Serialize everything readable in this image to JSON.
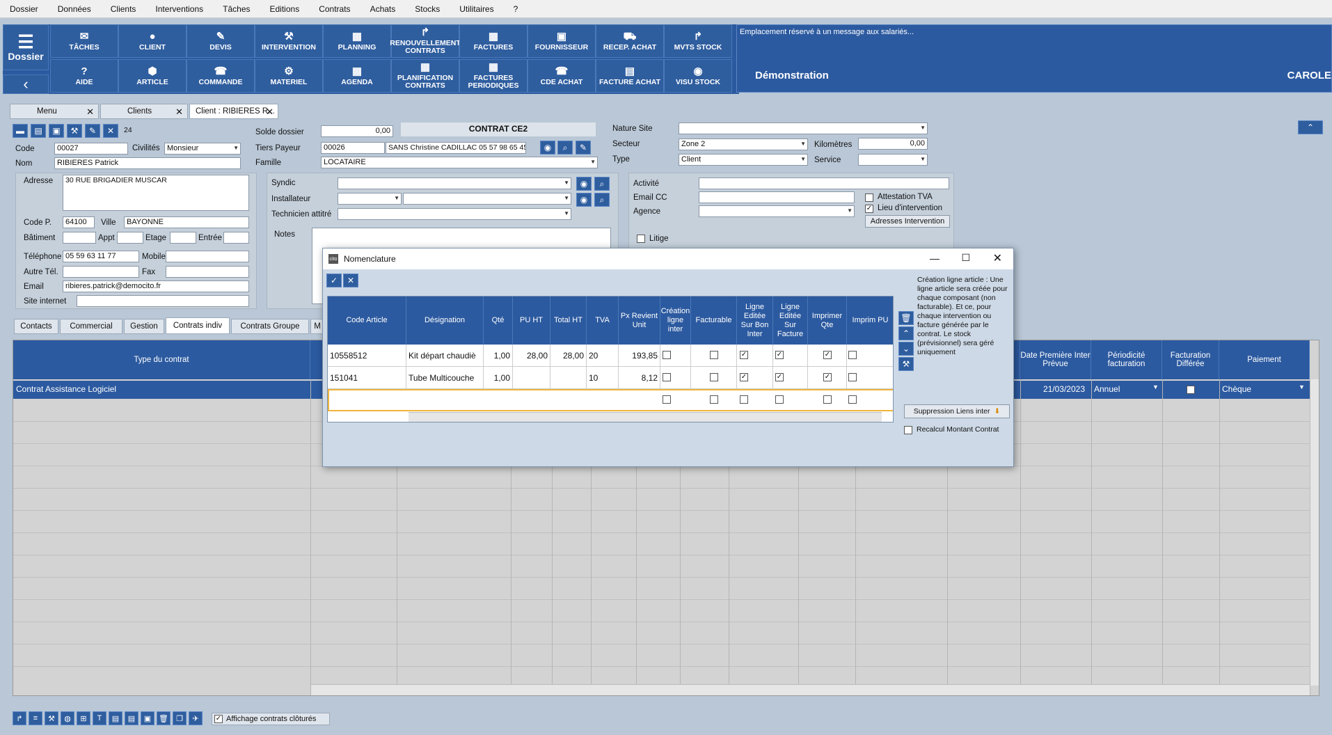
{
  "menu": [
    "Dossier",
    "Données",
    "Clients",
    "Interventions",
    "Tâches",
    "Editions",
    "Contrats",
    "Achats",
    "Stocks",
    "Utilitaires",
    "?"
  ],
  "toolbar": {
    "dossier": "Dossier",
    "row1": [
      "TÂCHES",
      "CLIENT",
      "DEVIS",
      "INTERVENTION",
      "PLANNING",
      "RENOUVELLEMENT CONTRATS",
      "FACTURES",
      "FOURNISSEUR",
      "RECEP. ACHAT",
      "MVTS STOCK"
    ],
    "row2": [
      "AIDE",
      "ARTICLE",
      "COMMANDE",
      "MATERIEL",
      "AGENDA",
      "PLANIFICATION CONTRATS",
      "FACTURES PERIODIQUES",
      "CDE ACHAT",
      "FACTURE ACHAT",
      "VISU STOCK"
    ]
  },
  "message": {
    "text": "Emplacement réservé à un  message aux salariés...",
    "company": "Démonstration",
    "user": "CAROLE"
  },
  "tabs": [
    "Menu",
    "Clients",
    "Client : RIBIERES R..."
  ],
  "form": {
    "count": "24",
    "code_label": "Code",
    "code": "00027",
    "civ_label": "Civilités",
    "civ": "Monsieur",
    "nom_label": "Nom",
    "nom": "RIBIERES Patrick",
    "solde_label": "Solde dossier",
    "solde": "0,00",
    "contrat_title": "CONTRAT CE2",
    "tiers_label": "Tiers Payeur",
    "tiers_code": "00026",
    "tiers_name": "SANS Christine CADILLAC 05 57 98 65 45",
    "famille_label": "Famille",
    "famille": "LOCATAIRE",
    "nature_label": "Nature Site",
    "secteur_label": "Secteur",
    "secteur": "Zone 2",
    "km_label": "Kilomètres",
    "km": "0,00",
    "type_label": "Type",
    "type": "Client",
    "service_label": "Service",
    "adresse_label": "Adresse",
    "adresse": "30 RUE BRIGADIER MUSCAR",
    "cp_label": "Code P.",
    "cp": "64100",
    "ville_label": "Ville",
    "ville": "BAYONNE",
    "bat_label": "Bâtiment",
    "appt_label": "Appt",
    "etage_label": "Etage",
    "entree_label": "Entrée",
    "tel_label": "Téléphone",
    "tel": "05 59 63 11 77",
    "mobile_label": "Mobile",
    "autre_label": "Autre Tél.",
    "fax_label": "Fax",
    "email_label": "Email",
    "email": "ribieres.patrick@democito.fr",
    "site_label": "Site internet",
    "syndic_label": "Syndic",
    "install_label": "Installateur",
    "tech_label": "Technicien attitré",
    "notes_label": "Notes",
    "activite_label": "Activité",
    "emailcc_label": "Email CC",
    "agence_label": "Agence",
    "attest_label": "Attestation TVA",
    "lieu_label": "Lieu d'intervention",
    "adr_btn": "Adresses Intervention",
    "litige_label": "Litige"
  },
  "subtabs": [
    "Contacts",
    "Commercial",
    "Gestion",
    "Contrats indiv",
    "Contrats Groupe",
    "M"
  ],
  "grid": {
    "headers": {
      "type": "Type du contrat",
      "date": "Date Première Inter Prévue",
      "period": "Périodicité facturation",
      "factdiff": "Facturation Différée",
      "paiement": "Paiement"
    },
    "row": {
      "type": "Contrat Assistance Logiciel",
      "date": "21/03/2023",
      "period": "Annuel",
      "paiement": "Chèque"
    }
  },
  "modal": {
    "title": "Nomenclature",
    "headers": [
      "Code Article",
      "Désignation",
      "Qté",
      "PU HT",
      "Total HT",
      "TVA",
      "Px Revient Unit",
      "Création ligne inter",
      "Facturable",
      "Ligne Editée Sur Bon Inter",
      "Ligne Editée Sur Facture",
      "Imprimer Qte",
      "Imprim PU"
    ],
    "rows": [
      {
        "code": "10558512",
        "des": "Kit départ chaudiè",
        "qte": "1,00",
        "pu": "28,00",
        "total": "28,00",
        "tva": "20",
        "px": "193,85",
        "c": [
          false,
          false,
          true,
          true,
          true,
          false
        ]
      },
      {
        "code": "151041",
        "des": "Tube Multicouche",
        "qte": "1,00",
        "pu": "",
        "total": "",
        "tva": "10",
        "px": "8,12",
        "c": [
          false,
          false,
          true,
          true,
          true,
          false
        ]
      }
    ],
    "info": "Création ligne article : Une ligne article sera créée pour chaque composant (non facturable). Et ce, pour chaque intervention ou facture générée par le contrat. Le stock (prévisionnel) sera géré uniquement",
    "supp_btn": "Suppression Liens inter",
    "recalc_label": "Recalcul Montant Contrat"
  },
  "footer": {
    "show_closed": "Affichage contrats clôturés"
  }
}
